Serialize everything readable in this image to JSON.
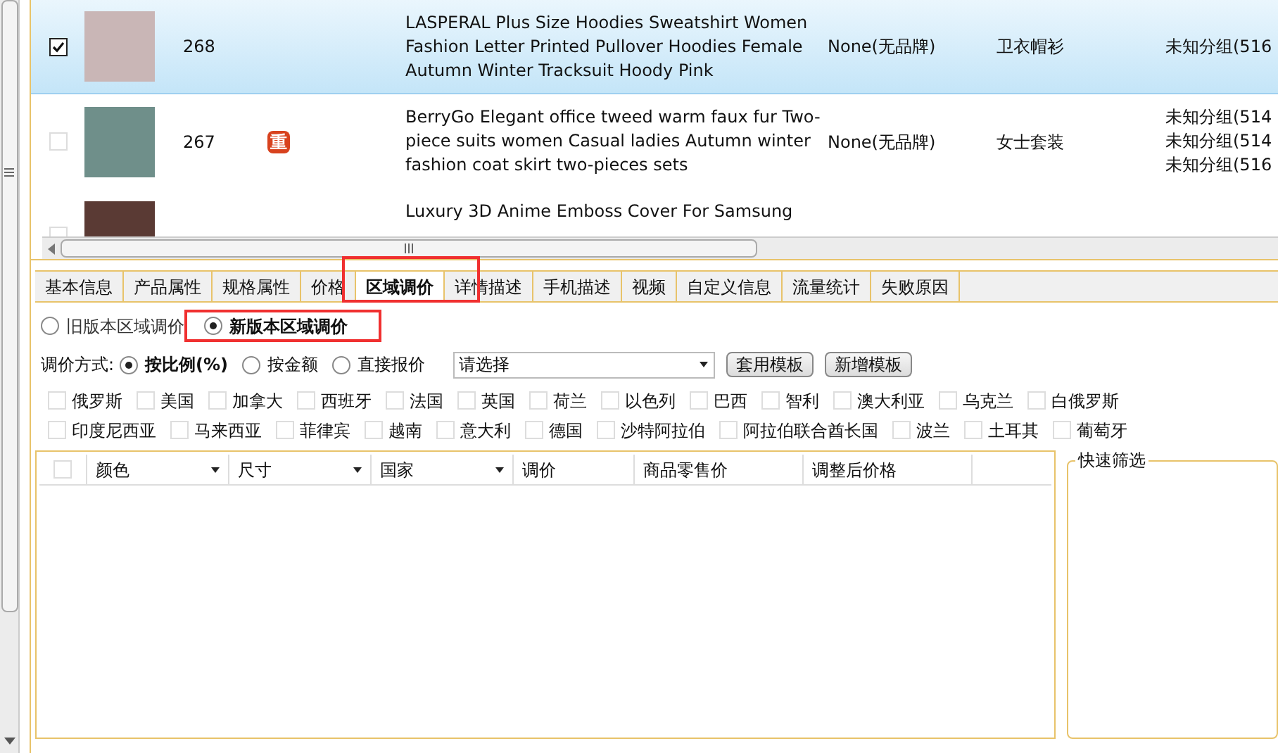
{
  "products": [
    {
      "checked": true,
      "selected": true,
      "id": "268",
      "title": [
        "LASPERAL Plus Size Hoodies Sweatshirt Women",
        "Fashion Letter Printed Pullover Hoodies Female",
        "Autumn Winter Tracksuit Hoody Pink"
      ],
      "brand": "None(无品牌)",
      "category": "卫衣帽衫",
      "groups": [
        "未知分组(516"
      ]
    },
    {
      "checked": false,
      "selected": false,
      "id": "267",
      "badge": "重",
      "title": [
        "BerryGo Elegant office tweed warm faux fur Two-",
        "piece suits women Casual ladies Autumn winter",
        "fashion coat skirt two-pieces sets"
      ],
      "brand": "None(无品牌)",
      "category": "女士套装",
      "groups": [
        "未知分组(514",
        "未知分组(514",
        "未知分组(516"
      ]
    },
    {
      "checked": false,
      "selected": false,
      "title": [
        "Luxury 3D Anime Emboss Cover For Samsung"
      ]
    }
  ],
  "tabs": [
    {
      "label": "基本信息",
      "selected": false
    },
    {
      "label": "产品属性",
      "selected": false
    },
    {
      "label": "规格属性",
      "selected": false
    },
    {
      "label": "价格",
      "selected": false
    },
    {
      "label": "区域调价",
      "selected": true
    },
    {
      "label": "详情描述",
      "selected": false
    },
    {
      "label": "手机描述",
      "selected": false
    },
    {
      "label": "视频",
      "selected": false
    },
    {
      "label": "自定义信息",
      "selected": false
    },
    {
      "label": "流量统计",
      "selected": false
    },
    {
      "label": "失败原因",
      "selected": false
    }
  ],
  "versions": [
    {
      "label": "旧版本区域调价",
      "selected": false
    },
    {
      "label": "新版本区域调价",
      "selected": true
    }
  ],
  "method": {
    "label": "调价方式:",
    "options": [
      {
        "label": "按比例(%)",
        "selected": true
      },
      {
        "label": "按金额",
        "selected": false
      },
      {
        "label": "直接报价",
        "selected": false
      }
    ],
    "template_select": "请选择",
    "buttons": [
      "套用模板",
      "新增模板"
    ]
  },
  "countries": [
    [
      {
        "label": "俄罗斯",
        "checked": false
      },
      {
        "label": "美国",
        "checked": false
      },
      {
        "label": "加拿大",
        "checked": false
      },
      {
        "label": "西班牙",
        "checked": false
      },
      {
        "label": "法国",
        "checked": false
      },
      {
        "label": "英国",
        "checked": false
      },
      {
        "label": "荷兰",
        "checked": false
      },
      {
        "label": "以色列",
        "checked": false
      },
      {
        "label": "巴西",
        "checked": false
      },
      {
        "label": "智利",
        "checked": false
      },
      {
        "label": "澳大利亚",
        "checked": false
      },
      {
        "label": "乌克兰",
        "checked": false
      },
      {
        "label": "白俄罗斯",
        "checked": false
      }
    ],
    [
      {
        "label": "印度尼西亚",
        "checked": false
      },
      {
        "label": "马来西亚",
        "checked": false
      },
      {
        "label": "菲律宾",
        "checked": false
      },
      {
        "label": "越南",
        "checked": false
      },
      {
        "label": "意大利",
        "checked": false
      },
      {
        "label": "德国",
        "checked": false
      },
      {
        "label": "沙特阿拉伯",
        "checked": false
      },
      {
        "label": "阿拉伯联合酋长国",
        "checked": false
      },
      {
        "label": "波兰",
        "checked": false
      },
      {
        "label": "土耳其",
        "checked": false
      },
      {
        "label": "葡萄牙",
        "checked": false
      }
    ]
  ],
  "grid": {
    "select_all_checked": false,
    "columns": [
      {
        "label": "颜色",
        "filter": true
      },
      {
        "label": "尺寸",
        "filter": true
      },
      {
        "label": "国家",
        "filter": true
      },
      {
        "label": "调价",
        "filter": false
      },
      {
        "label": "商品零售价",
        "filter": false
      },
      {
        "label": "调整后价格",
        "filter": false
      }
    ]
  },
  "quick_filter": {
    "title": "快速筛选"
  }
}
